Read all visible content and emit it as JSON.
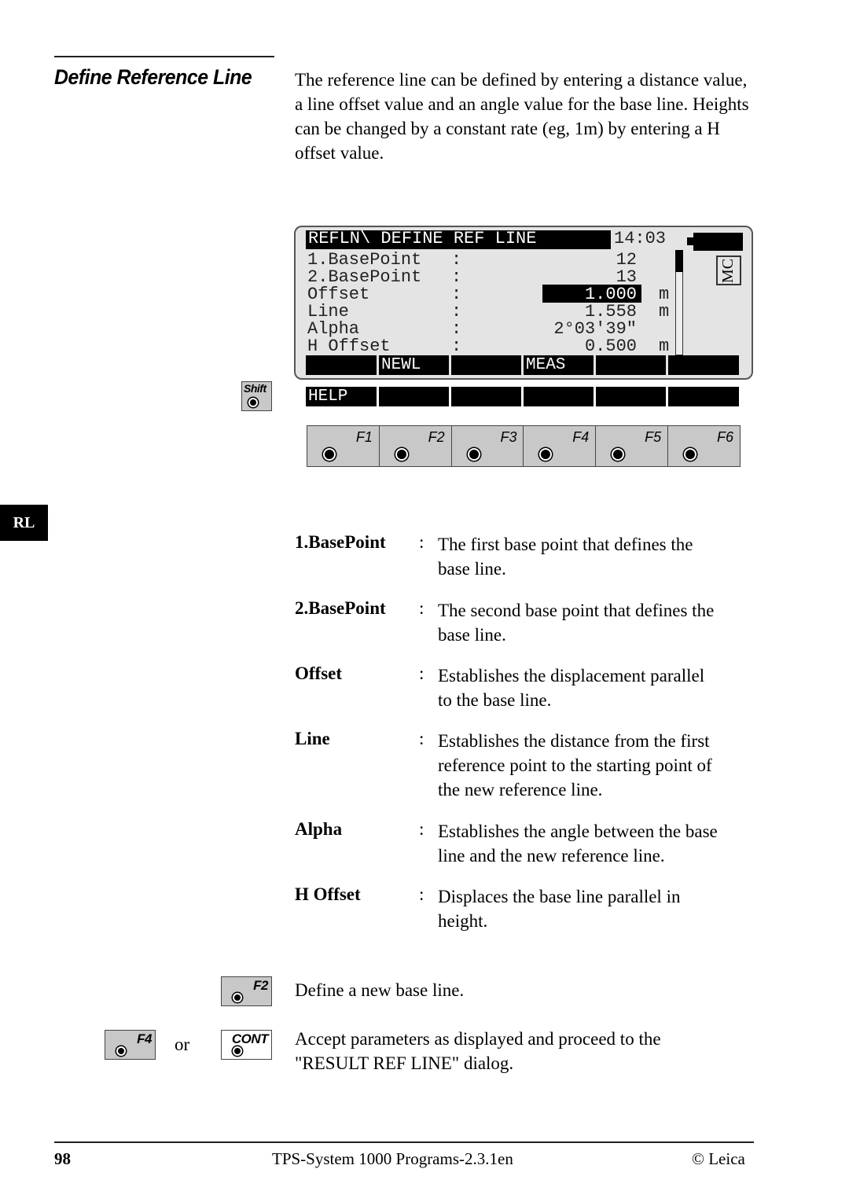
{
  "section": {
    "title": "Define Reference Line",
    "intro": "The reference line can be defined by entering a distance value, a line offset value and an angle value for the base line. Heights can be changed by a constant rate (eg, 1m) by entering a H offset value."
  },
  "screen": {
    "title": "REFLN\\ DEFINE REF LINE",
    "clock": "14:03",
    "mode_badge": "MC",
    "battery_icon": "battery-icon",
    "scroll_position": 0.0,
    "rows": [
      {
        "label": "1.BasePoint",
        "colon": ":",
        "value": "12",
        "unit": ""
      },
      {
        "label": "2.BasePoint",
        "colon": ":",
        "value": "13",
        "unit": ""
      },
      {
        "label": "Offset",
        "colon": ":",
        "value": "1.000",
        "unit": "m",
        "selected": true
      },
      {
        "label": "Line",
        "colon": ":",
        "value": "1.558",
        "unit": "m"
      },
      {
        "label": "Alpha",
        "colon": ":",
        "value": "2°03'39\"",
        "unit": ""
      },
      {
        "label": "H Offset",
        "colon": ":",
        "value": "0.500",
        "unit": "m"
      }
    ],
    "softkeys": [
      "",
      "NEWL",
      "",
      "MEAS",
      "",
      ""
    ],
    "shift_softkeys": [
      "HELP",
      "",
      "",
      "",
      "",
      ""
    ]
  },
  "keys": {
    "shift": "Shift",
    "function_keys": [
      "F1",
      "F2",
      "F3",
      "F4",
      "F5",
      "F6"
    ],
    "f2": "F2",
    "f4": "F4",
    "cont": "CONT",
    "or": "or"
  },
  "side_tab": "RL",
  "definitions": [
    {
      "term": "1.BasePoint",
      "colon": ":",
      "lines": [
        "The first base point that defines the",
        "base  line."
      ]
    },
    {
      "term": "2.BasePoint",
      "colon": ":",
      "lines": [
        "The second base point that defines the",
        "base line."
      ]
    },
    {
      "term": "Offset",
      "colon": ":",
      "lines": [
        "Establishes the displacement parallel",
        "to the base line."
      ]
    },
    {
      "term": "Line",
      "colon": ":",
      "lines": [
        "Establishes the distance from the first",
        "reference point to the starting point of",
        "the new reference line."
      ]
    },
    {
      "term": "Alpha",
      "colon": ":",
      "lines": [
        "Establishes the angle between the base",
        "line and the new reference line."
      ]
    },
    {
      "term": "H Offset",
      "colon": ":",
      "lines": [
        "Displaces the base line parallel in",
        "height."
      ]
    }
  ],
  "actions": {
    "f2_text": "Define  a new base  line.",
    "cont_text_1": "Accept parameters as displayed and proceed to the",
    "cont_text_2": "\"RESULT REF LINE\" dialog."
  },
  "footer": {
    "page": "98",
    "doc": "TPS-System 1000 Programs-2.3.1en",
    "copyright": "© Leica"
  }
}
